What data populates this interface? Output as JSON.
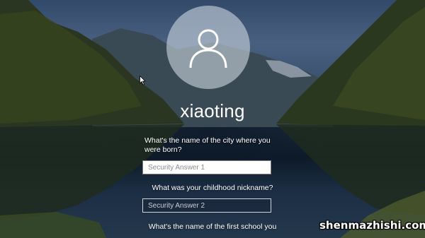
{
  "user": {
    "name": "xiaoting",
    "avatar_icon": "user-icon"
  },
  "security_questions": [
    {
      "question": "What's the name of the city where you were born?",
      "placeholder": "Security Answer 1",
      "value": ""
    },
    {
      "question": "What was your childhood nickname?",
      "placeholder": "Security Answer 2",
      "value": ""
    },
    {
      "question": "What's the name of the first school you",
      "placeholder": "",
      "value": ""
    }
  ],
  "watermark": "shenmazhishi.com",
  "colors": {
    "avatar_bg": "#c8d2dc",
    "text": "#ffffff",
    "input_border_active": "#7c7c7c"
  }
}
